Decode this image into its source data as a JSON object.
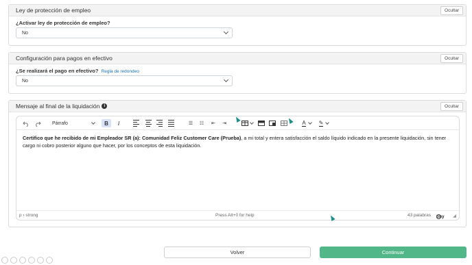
{
  "sections": {
    "employment": {
      "title": "Ley de protección de empleo",
      "hide_label": "Ocultar",
      "question": "¿Activar ley de protección de empleo?",
      "value": "No"
    },
    "cash": {
      "title": "Configuración para pagos en efectivo",
      "hide_label": "Ocultar",
      "question": "¿Se realizará el pago en efectivo?",
      "link": "Regla de redondeo",
      "value": "No"
    },
    "message": {
      "title": "Mensaje al final de la liquidación",
      "hide_label": "Ocultar",
      "info_icon": "i"
    }
  },
  "editor": {
    "block_format": "Párrafo",
    "bold_label": "B",
    "italic_label": "I",
    "text_color_label": "A",
    "body_bold": "Certifico que he recibido de mi Empleador SR (a): Comunidad Feliz Customer Care (Prueba)",
    "body_rest": ", a mi total y entera satisfacción el saldo líquido indicado en la presente liquidación, sin tener cargo ni cobro posterior alguno que hacer, por los conceptos de esta liquidación.",
    "status_path": "p › strong",
    "status_help": "Press Alt+0 for help",
    "word_count": "43 palabras",
    "brand": "tiny"
  },
  "actions": {
    "back": "Volver",
    "continue": "Continuar"
  },
  "colors": {
    "continue_bg": "#52b788",
    "link": "#1a6fbf",
    "cursor": "#1d8f8a"
  }
}
